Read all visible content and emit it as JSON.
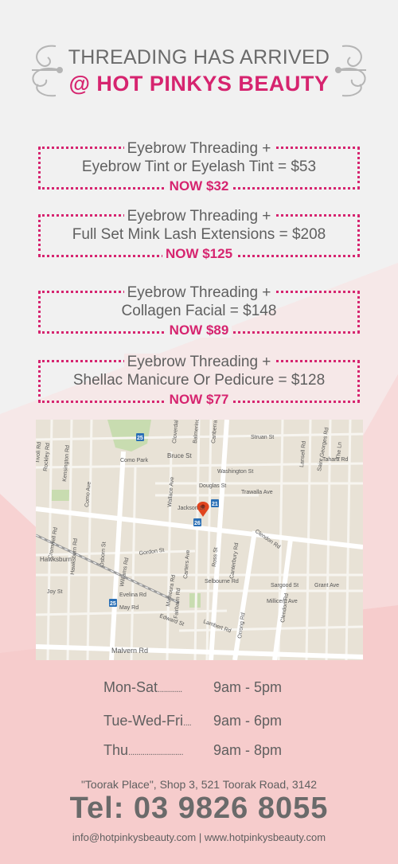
{
  "colors": {
    "accent": "#d6246f",
    "text": "#5f5f5f",
    "pink_bg": "#f6cccc"
  },
  "header": {
    "line1": "THREADING HAS ARRIVED",
    "line2": "@ HOT PINKYS BEAUTY"
  },
  "offers": [
    {
      "line1": "Eyebrow Threading +",
      "line2": "Eyebrow Tint or Eyelash Tint = $53",
      "now": "NOW $32"
    },
    {
      "line1": "Eyebrow Threading +",
      "line2": "Full Set Mink Lash Extensions = $208",
      "now": "NOW $125"
    },
    {
      "line1": "Eyebrow Threading +",
      "line2": "Collagen Facial = $148",
      "now": "NOW $89"
    },
    {
      "line1": "Eyebrow Threading +",
      "line2": "Shellac Manicure Or Pedicure = $128",
      "now": "NOW $77"
    }
  ],
  "map": {
    "labels": {
      "como_park": "Como Park",
      "bruce_st": "Bruce St",
      "struan_st": "Struan St",
      "washington_st": "Washington St",
      "douglas_st": "Douglas St",
      "trawalla_ave": "Trawalla Ave",
      "jackson_st": "Jackson St",
      "clendon_rd": "Clendon Rd",
      "gordon_st": "Gordon St",
      "hawksburn": "Hawksburn",
      "joy_st": "Joy St",
      "evelina_rd": "Evelina Rd",
      "may_rd": "May Rd",
      "malvern_rd": "Malvern Rd",
      "selbourne_rd": "Selbourne Rd",
      "sargood_st": "Sargood St",
      "grant_ave": "Grant Ave",
      "millicent_ave": "Millicent Ave",
      "lambert_rd": "Lambert Rd",
      "edward_st": "Edward St",
      "williams_rd": "Williams Rd",
      "mathoura_rd": "Mathoura Rd",
      "canterbury_rd": "Canterbury Rd",
      "orrong_rd": "Orrong Rd",
      "clendon_rd_v": "Clendon Rd",
      "saint_georges_rd": "Saint Georges Rd",
      "tahara_rd": "Tahara Rd",
      "kensington_rd": "Kensington Rd",
      "rockley_rd": "Rockley Rd",
      "tivoli_rd": "Tivoli Rd",
      "como_ave": "Como Ave",
      "wallace_ave": "Wallace Ave",
      "carters_ave": "Carters Ave",
      "ross_st": "Ross St",
      "fairbairn_rd": "Fairbairn Rd",
      "hawksburn_rd": "Hawksburn Rd",
      "cromwell_rd": "Cromwell Rd",
      "osborn_st": "Osborn St",
      "lansell_rd": "Lansell Rd",
      "the_ln": "The Ln",
      "cloverdale_ave": "Cloverdale Ave",
      "balmerino_ave": "Balmerino Ave",
      "canberra_rd": "Canberra Rd",
      "route_25": "25",
      "route_21": "21",
      "route_26": "26"
    }
  },
  "hours": [
    {
      "day": "Mon-Sat",
      "dots": "............",
      "time": "9am - 5pm"
    },
    {
      "day": "Tue-Wed-Fri",
      "dots": "....",
      "time": "9am - 6pm"
    },
    {
      "day": "Thu",
      "dots": "...........................",
      "time": "9am - 8pm"
    }
  ],
  "footer": {
    "address": "\"Toorak Place\", Shop 3, 521 Toorak Road, 3142",
    "tel": "Tel: 03 9826 8055",
    "contact": "info@hotpinkysbeauty.com  |  www.hotpinkysbeauty.com"
  }
}
